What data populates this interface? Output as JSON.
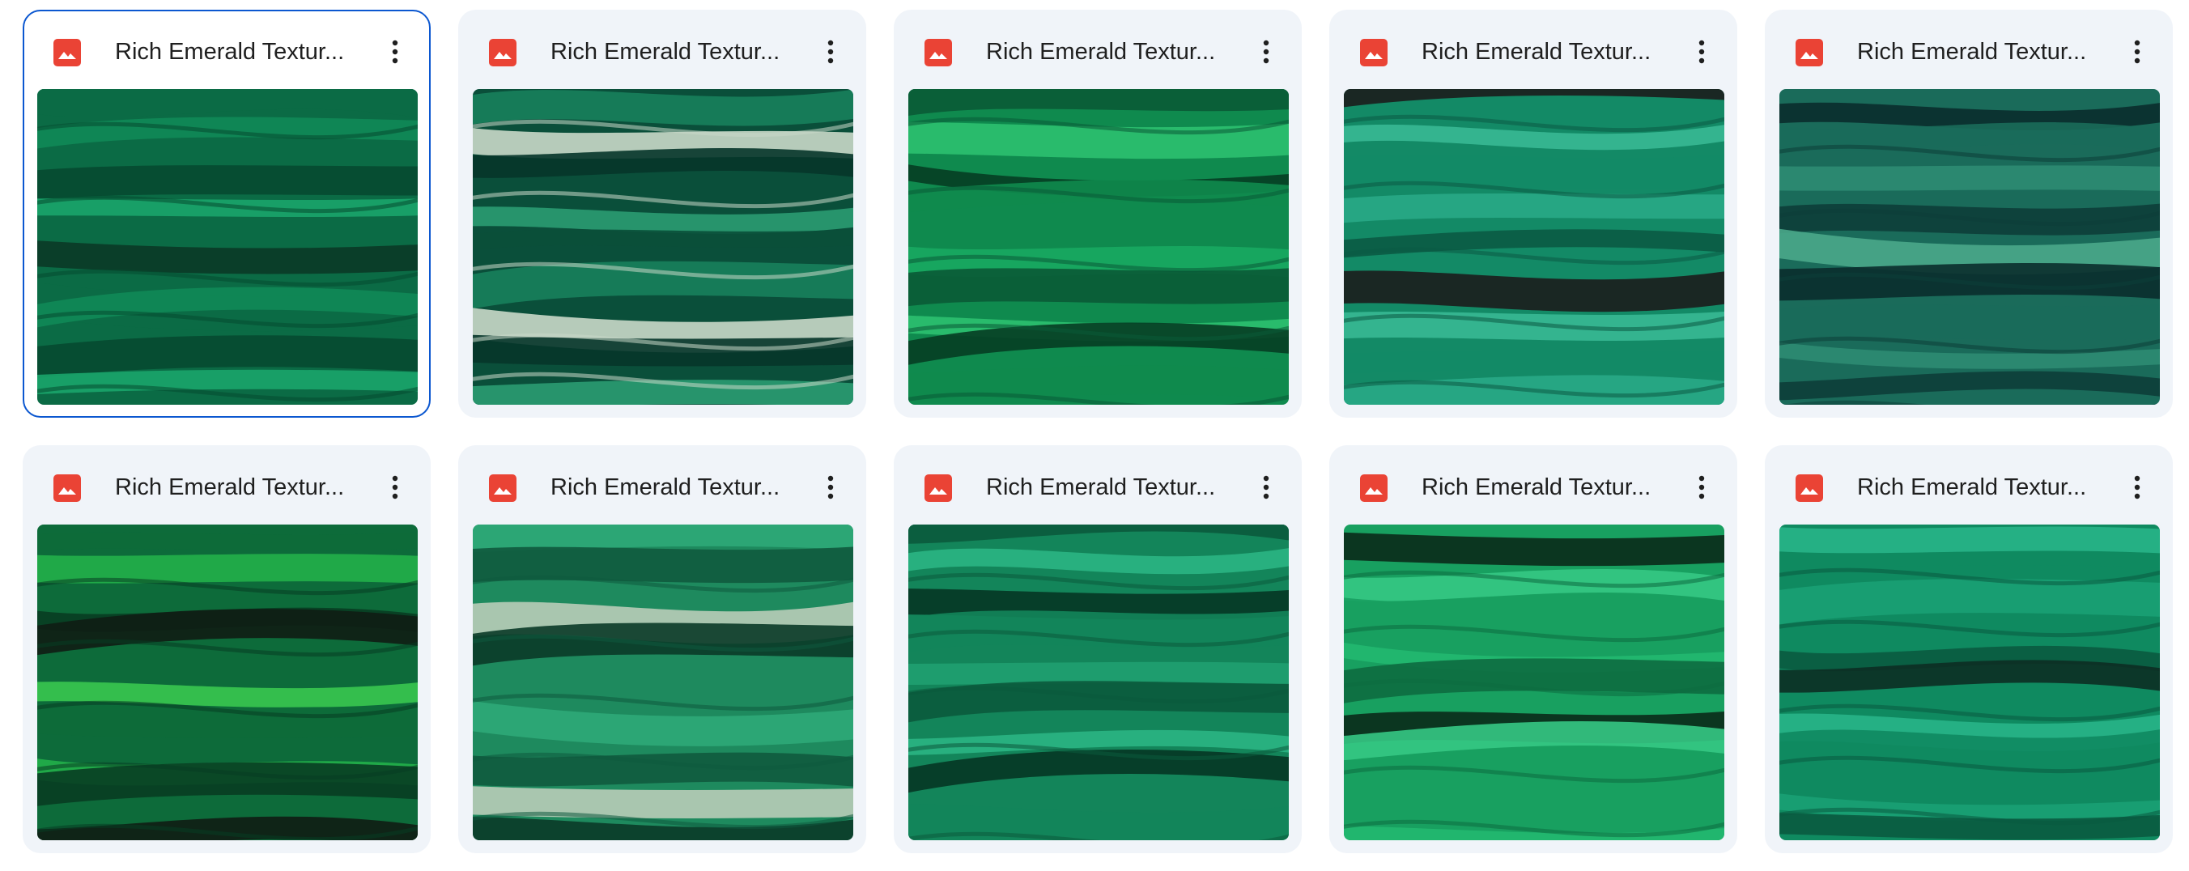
{
  "files": [
    {
      "name": "Rich Emerald Textur...",
      "selected": true,
      "palette": [
        "#0b6b45",
        "#0f8a57",
        "#064a30",
        "#1aa56a",
        "#0a3a26"
      ]
    },
    {
      "name": "Rich Emerald Textur...",
      "selected": false,
      "palette": [
        "#0a4f3a",
        "#17805c",
        "#c9d8c9",
        "#06352a",
        "#2a9b72"
      ]
    },
    {
      "name": "Rich Emerald Textur...",
      "selected": false,
      "palette": [
        "#0f8a4e",
        "#18a862",
        "#0a5a36",
        "#2cc070",
        "#063d24"
      ]
    },
    {
      "name": "Rich Emerald Textur...",
      "selected": false,
      "palette": [
        "#138a66",
        "#29a886",
        "#0b5a44",
        "#1c1c1c",
        "#39b894"
      ]
    },
    {
      "name": "Rich Emerald Textur...",
      "selected": false,
      "palette": [
        "#1a6b5a",
        "#2e8c72",
        "#0d3e38",
        "#4aa88a",
        "#0a2e2c"
      ]
    },
    {
      "name": "Rich Emerald Textur...",
      "selected": false,
      "palette": [
        "#0d6b3a",
        "#22b04a",
        "#083d22",
        "#101d14",
        "#39c850"
      ]
    },
    {
      "name": "Rich Emerald Textur...",
      "selected": false,
      "palette": [
        "#1e8a5e",
        "#2ea878",
        "#0f5a3e",
        "#b8ccb8",
        "#0a3a28"
      ]
    },
    {
      "name": "Rich Emerald Textur...",
      "selected": false,
      "palette": [
        "#13855a",
        "#20a070",
        "#0b5a3c",
        "#2bb583",
        "#063624"
      ]
    },
    {
      "name": "Rich Emerald Textur...",
      "selected": false,
      "palette": [
        "#18a060",
        "#22b870",
        "#0d6b40",
        "#0a2a1a",
        "#35c884"
      ]
    },
    {
      "name": "Rich Emerald Textur...",
      "selected": false,
      "palette": [
        "#0f8a60",
        "#1aa074",
        "#0a5a40",
        "#0c2e24",
        "#28b488"
      ]
    }
  ],
  "icons": {
    "file_type": "image-file-icon",
    "more": "more-vert-icon"
  },
  "colors": {
    "card_bg": "#f0f4f9",
    "selected_border": "#0b57d0",
    "image_icon": "#ea4335"
  }
}
